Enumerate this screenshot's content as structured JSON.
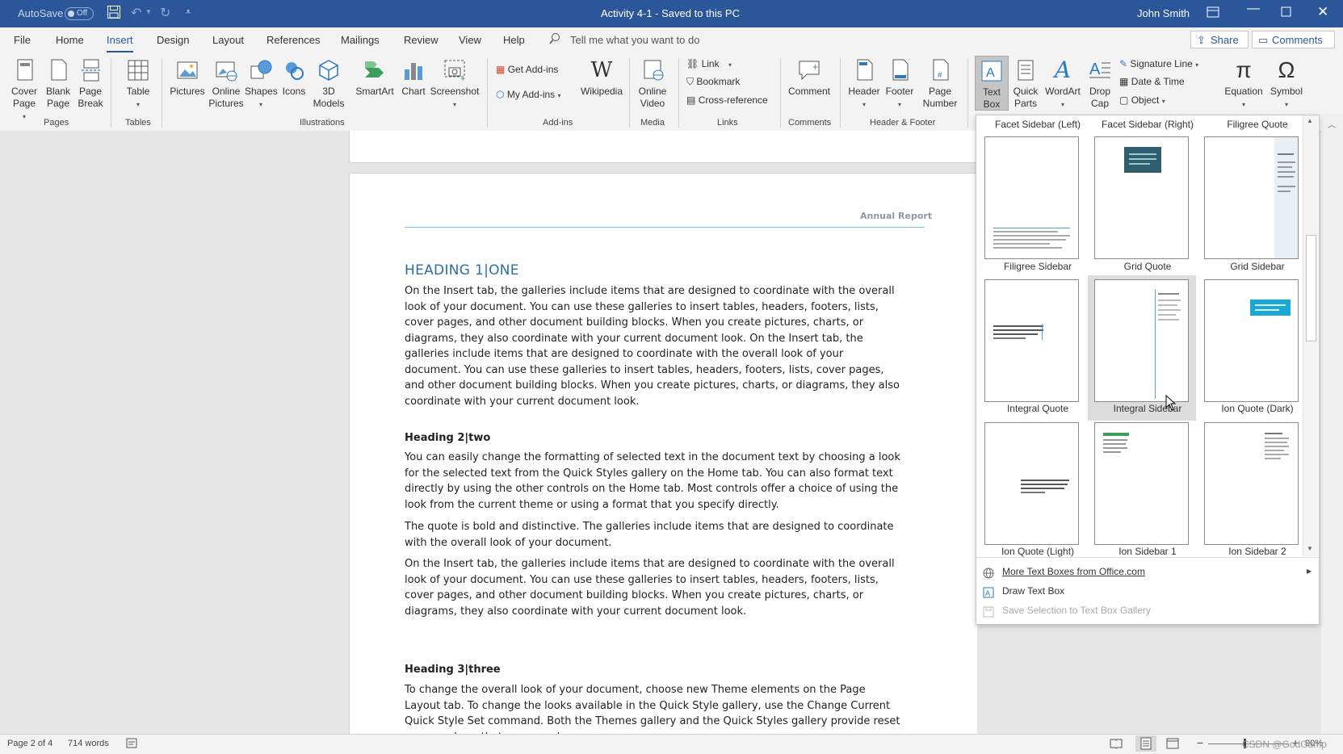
{
  "titlebar": {
    "autosave_label": "AutoSave",
    "autosave_state": "Off",
    "doc_title": "Activity 4-1  -  Saved to this PC",
    "user": "John Smith"
  },
  "tabs": [
    "File",
    "Home",
    "Insert",
    "Design",
    "Layout",
    "References",
    "Mailings",
    "Review",
    "View",
    "Help"
  ],
  "tell_me": "Tell me what you want to do",
  "share_label": "Share",
  "comments_label": "Comments",
  "ribbon": {
    "pages": {
      "group": "Pages",
      "cover": "Cover Page",
      "blank": "Blank Page",
      "break": "Page Break"
    },
    "tables": {
      "group": "Tables",
      "table": "Table"
    },
    "illustrations": {
      "group": "Illustrations",
      "pictures": "Pictures",
      "online_pictures": "Online Pictures",
      "shapes": "Shapes",
      "icons": "Icons",
      "models": "3D Models",
      "smartart": "SmartArt",
      "chart": "Chart",
      "screenshot": "Screenshot"
    },
    "addins": {
      "group": "Add-ins",
      "get": "Get Add-ins",
      "my": "My Add-ins",
      "wikipedia": "Wikipedia"
    },
    "media": {
      "group": "Media",
      "video": "Online Video"
    },
    "links": {
      "group": "Links",
      "link": "Link",
      "bookmark": "Bookmark",
      "cross": "Cross-reference"
    },
    "comments": {
      "group": "Comments",
      "comment": "Comment"
    },
    "hf": {
      "group": "Header & Footer",
      "header": "Header",
      "footer": "Footer",
      "page_number": "Page Number"
    },
    "text": {
      "text_box": "Text Box",
      "quick_parts": "Quick Parts",
      "wordart": "WordArt",
      "drop_cap": "Drop Cap",
      "signature": "Signature Line",
      "datetime": "Date & Time",
      "object": "Object"
    },
    "symbols": {
      "equation": "Equation",
      "symbol": "Symbol"
    }
  },
  "document": {
    "header_text": "Annual Report",
    "heading1": "HEADING 1|ONE",
    "para1": "On the Insert tab, the galleries include items that are designed to coordinate with the overall look of your document.  You can use these galleries to insert tables, headers, footers, lists, cover pages, and other document building blocks.  When you create pictures, charts, or diagrams, they also coordinate with your current document look. On the Insert tab, the galleries include items that are designed to coordinate with the overall look of your document.  You can use these galleries to insert tables, headers, footers, lists, cover pages, and other document building blocks.  When you create pictures, charts, or diagrams, they also coordinate with your current document look.",
    "heading2": "Heading 2|two",
    "para2": "You can easily change the formatting of selected text in the document text by choosing a look for the selected text from the Quick Styles gallery on the Home tab. You can also format text directly by using the other controls on the Home tab. Most controls offer a choice of using the look from the current theme or using a format that you specify directly.",
    "para3": "The quote is bold and distinctive. The galleries include items that are designed to coordinate with the overall look of your document.",
    "para4": "On the Insert tab, the galleries include items that are designed to coordinate with the overall look of your document.  You can use these galleries to insert tables, headers, footers, lists, cover pages, and other document building blocks.  When you create pictures, charts, or diagrams, they also coordinate with your current document look.",
    "heading3": "Heading 3|three",
    "para5": "To change the overall look of your document, choose new Theme elements on the Page Layout tab.  To change the looks available in the Quick Style gallery, use the Change Current Quick Style Set command.  Both the Themes gallery and the Quick Styles gallery provide reset commands so that you can always"
  },
  "gallery": {
    "top_labels": [
      "Facet Sidebar (Left)",
      "Facet Sidebar (Right)",
      "Filigree Quote"
    ],
    "rows": [
      [
        "Filigree Sidebar",
        "Grid Quote",
        "Grid Sidebar"
      ],
      [
        "Integral Quote",
        "Integral Sidebar",
        "Ion Quote (Dark)"
      ],
      [
        "Ion Quote (Light)",
        "Ion Sidebar 1",
        "Ion Sidebar 2"
      ]
    ],
    "more": "More Text Boxes from Office.com",
    "draw": "Draw Text Box",
    "save": "Save Selection to Text Box Gallery"
  },
  "status": {
    "page": "Page 2 of 4",
    "words": "714 words",
    "zoom": "90%",
    "watermark": "CSDN @GodGump"
  }
}
